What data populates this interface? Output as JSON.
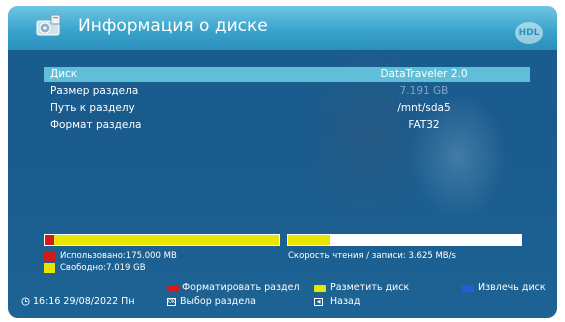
{
  "header": {
    "title": "Информация о диске",
    "badge": "HDL"
  },
  "rows": [
    {
      "key": "Диск",
      "value": "DataTraveler 2.0"
    },
    {
      "key": "Размер раздела",
      "value": "7.191 GB"
    },
    {
      "key": "Путь к разделу",
      "value": "/mnt/sda5"
    },
    {
      "key": "Формат раздела",
      "value": "FAT32"
    }
  ],
  "usage": {
    "used_label": "Использовано:175.000 MB",
    "free_label": "Свободно:7.019 GB",
    "used_fraction": 0.024,
    "speed_label": "Скорость  чтения / записи: 3.625 MB/s",
    "speed_fraction": 0.18
  },
  "footer": {
    "time": "16:16 29/08/2022 Пн",
    "red_action": "Форматировать раздел",
    "yellow_action": "Разметить диск",
    "blue_action": "Извлечь диск",
    "select_action": "Выбор раздела",
    "back_action": "Назад"
  },
  "colors": {
    "red": "#d21b1b",
    "yellow": "#e6e600",
    "blue": "#1f5fd6",
    "highlight": "#5fbfd9"
  }
}
